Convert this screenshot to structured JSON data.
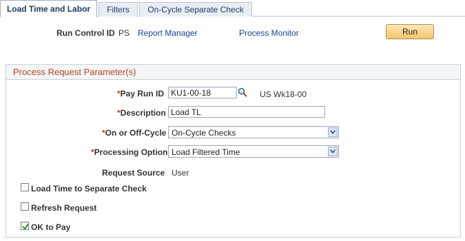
{
  "tabs": [
    {
      "label": "Load Time and Labor"
    },
    {
      "label": "Filters"
    },
    {
      "label": "On-Cycle Separate Check"
    }
  ],
  "run_control": {
    "label": "Run Control ID",
    "value": "PS",
    "report_manager": "Report Manager",
    "process_monitor": "Process Monitor",
    "run_button": "Run"
  },
  "group": {
    "title": "Process Request Parameter(s)"
  },
  "fields": {
    "pay_run_id": {
      "label": "Pay Run ID",
      "value": "KU1-00-18",
      "description": "US Wk18-00"
    },
    "description": {
      "label": "Description",
      "value": "Load TL"
    },
    "on_off_cycle": {
      "label": "On or Off-Cycle",
      "value": "On-Cycle Checks"
    },
    "processing_option": {
      "label": "Processing Option",
      "value": "Load Filtered Time"
    },
    "request_source": {
      "label": "Request Source",
      "value": "User"
    }
  },
  "checkboxes": {
    "load_time_separate": {
      "label": "Load Time to Separate Check",
      "checked": false
    },
    "refresh_request": {
      "label": "Refresh Request",
      "checked": false
    },
    "ok_to_pay": {
      "label": "OK to Pay",
      "checked": true
    }
  },
  "colors": {
    "required_marker": "#b4461f",
    "link": "#1a3f8a",
    "group_title": "#b4461f"
  }
}
